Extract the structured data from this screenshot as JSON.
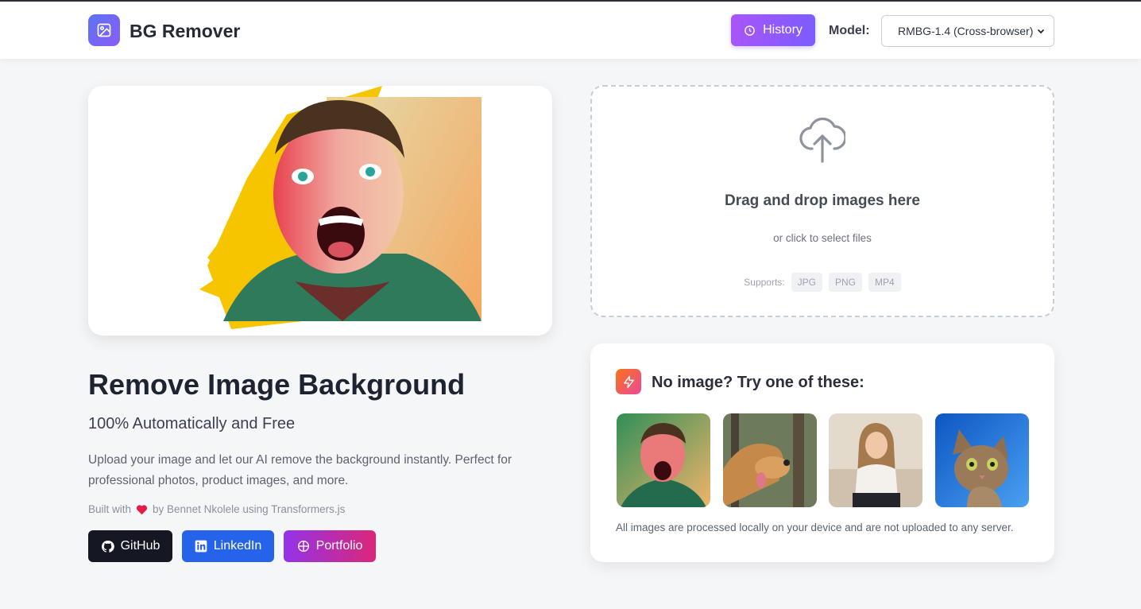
{
  "header": {
    "brand": "BG Remover",
    "history_label": "History",
    "model_label": "Model:",
    "model_value": "RMBG-1.4 (Cross-browser)"
  },
  "hero": {
    "title": "Remove Image Background",
    "subtitle": "100% Automatically and Free",
    "description": "Upload your image and let our AI remove the background instantly. Perfect for professional photos, product images, and more.",
    "built_prefix": "Built with",
    "built_suffix": "by Bennet Nkolele using Transformers.js",
    "links": {
      "github": "GitHub",
      "linkedin": "LinkedIn",
      "portfolio": "Portfolio"
    }
  },
  "dropzone": {
    "title": "Drag and drop images here",
    "subtitle": "or click to select files",
    "supports_label": "Supports:",
    "formats": [
      "JPG",
      "PNG",
      "MP4"
    ]
  },
  "samples": {
    "title": "No image? Try one of these:",
    "items": [
      "surprised-man",
      "dog",
      "smiling-woman",
      "cat"
    ],
    "note": "All images are processed locally on your device and are not uploaded to any server."
  },
  "colors": {
    "accent": "#7c5cff",
    "github": "#151823",
    "linkedin": "#2563eb"
  }
}
